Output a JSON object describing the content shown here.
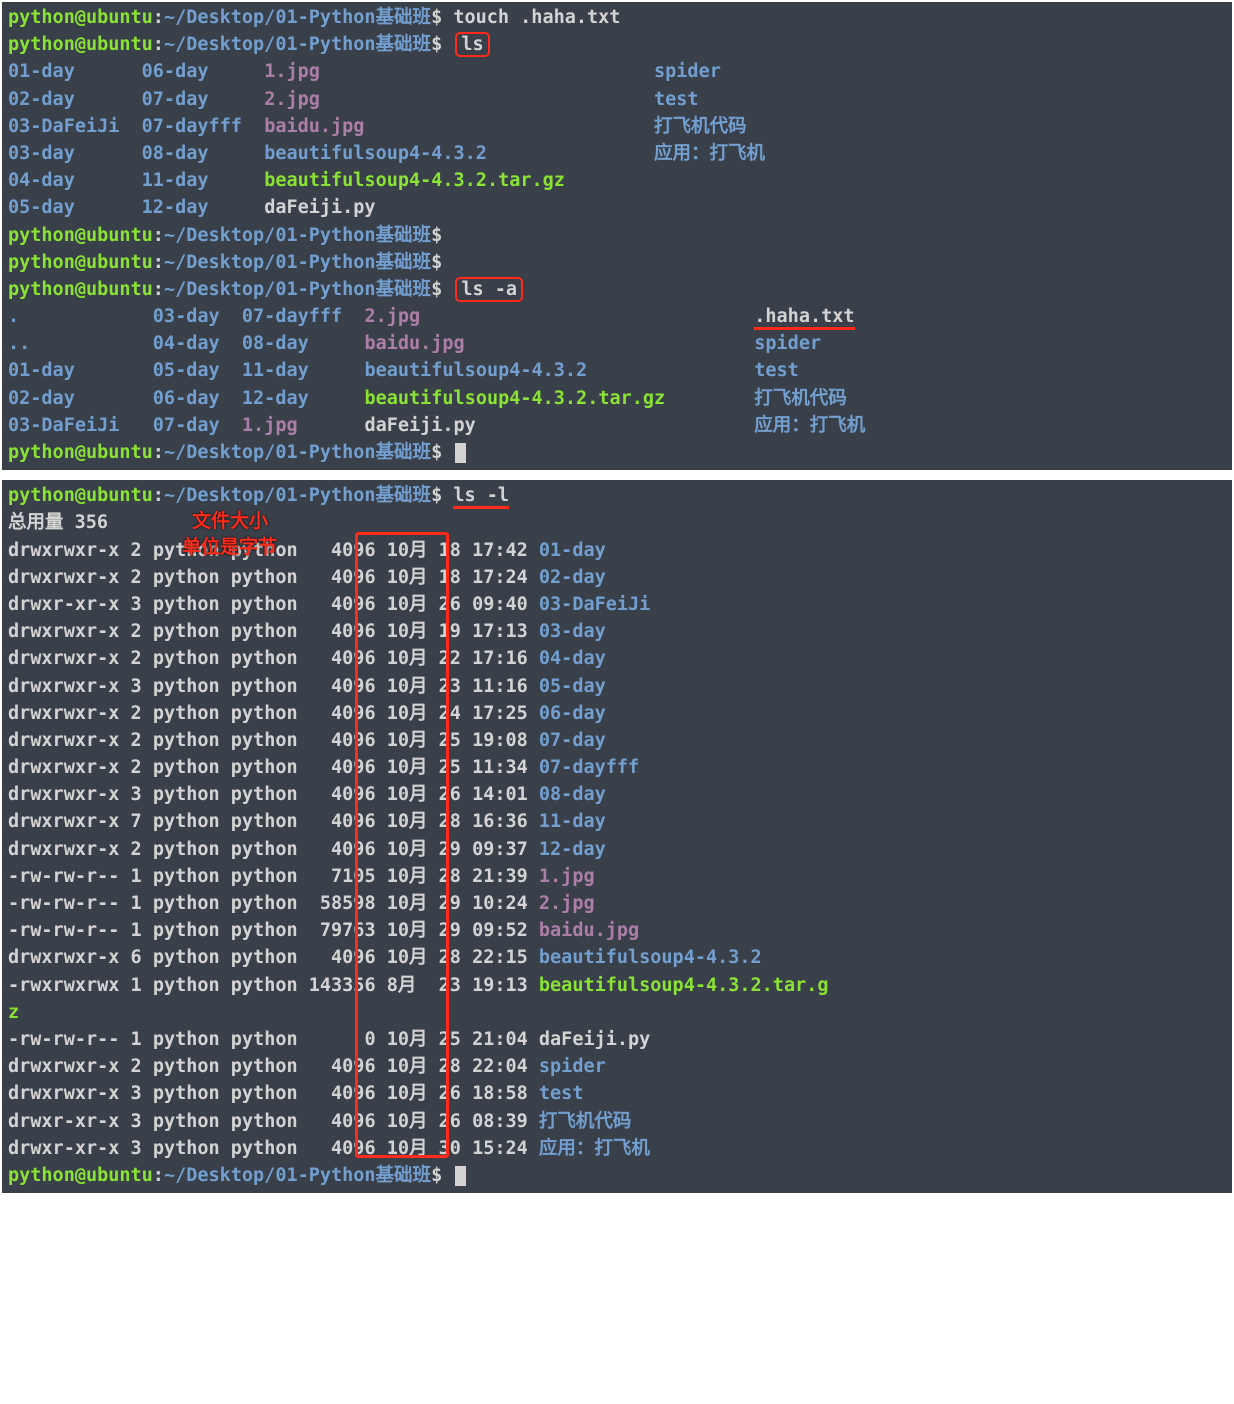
{
  "prompt": {
    "user": "python@ubuntu",
    "sep": ":",
    "path": "~/Desktop/01-Python基础班",
    "dollar": "$"
  },
  "cmds": {
    "touch": "touch .haha.txt",
    "ls": "ls",
    "ls_a": "ls -a",
    "ls_l": "ls -l"
  },
  "ls_plain": {
    "col1": [
      "01-day",
      "02-day",
      "03-DaFeiJi",
      "03-day",
      "04-day",
      "05-day"
    ],
    "col2": [
      "06-day",
      "07-day",
      "07-dayfff",
      "08-day",
      "11-day",
      "12-day"
    ],
    "col3": [
      "1.jpg",
      "2.jpg",
      "baidu.jpg",
      "beautifulsoup4-4.3.2",
      "beautifulsoup4-4.3.2.tar.gz",
      "daFeiji.py"
    ],
    "col4": [
      "spider",
      "test",
      "打飞机代码",
      "应用：打飞机",
      "",
      ""
    ]
  },
  "ls_a": {
    "col1": [
      ".",
      "..",
      "01-day",
      "02-day",
      "03-DaFeiJi"
    ],
    "col2": [
      "03-day",
      "04-day",
      "05-day",
      "06-day",
      "07-day"
    ],
    "col3": [
      "07-dayfff",
      "08-day",
      "11-day",
      "12-day",
      "1.jpg"
    ],
    "col4": [
      "2.jpg",
      "baidu.jpg",
      "beautifulsoup4-4.3.2",
      "beautifulsoup4-4.3.2.tar.gz",
      "daFeiji.py"
    ],
    "col5": [
      ".haha.txt",
      "spider",
      "test",
      "打飞机代码",
      "应用：打飞机"
    ]
  },
  "ls_l": {
    "total": "总用量 356",
    "annotation_line1": "文件大小",
    "annotation_line2": "单位是字节",
    "rows": [
      {
        "perm": "drwxrwxr-x",
        "n": "2",
        "u": "python",
        "g": "python",
        "size": "4096",
        "m": "10月",
        "d": "18",
        "t": "17:42",
        "name": "01-day",
        "cls": "dir"
      },
      {
        "perm": "drwxrwxr-x",
        "n": "2",
        "u": "python",
        "g": "python",
        "size": "4096",
        "m": "10月",
        "d": "18",
        "t": "17:24",
        "name": "02-day",
        "cls": "dir"
      },
      {
        "perm": "drwxr-xr-x",
        "n": "3",
        "u": "python",
        "g": "python",
        "size": "4096",
        "m": "10月",
        "d": "26",
        "t": "09:40",
        "name": "03-DaFeiJi",
        "cls": "dir"
      },
      {
        "perm": "drwxrwxr-x",
        "n": "2",
        "u": "python",
        "g": "python",
        "size": "4096",
        "m": "10月",
        "d": "19",
        "t": "17:13",
        "name": "03-day",
        "cls": "dir"
      },
      {
        "perm": "drwxrwxr-x",
        "n": "2",
        "u": "python",
        "g": "python",
        "size": "4096",
        "m": "10月",
        "d": "22",
        "t": "17:16",
        "name": "04-day",
        "cls": "dir"
      },
      {
        "perm": "drwxrwxr-x",
        "n": "3",
        "u": "python",
        "g": "python",
        "size": "4096",
        "m": "10月",
        "d": "23",
        "t": "11:16",
        "name": "05-day",
        "cls": "dir"
      },
      {
        "perm": "drwxrwxr-x",
        "n": "2",
        "u": "python",
        "g": "python",
        "size": "4096",
        "m": "10月",
        "d": "24",
        "t": "17:25",
        "name": "06-day",
        "cls": "dir"
      },
      {
        "perm": "drwxrwxr-x",
        "n": "2",
        "u": "python",
        "g": "python",
        "size": "4096",
        "m": "10月",
        "d": "25",
        "t": "19:08",
        "name": "07-day",
        "cls": "dir"
      },
      {
        "perm": "drwxrwxr-x",
        "n": "2",
        "u": "python",
        "g": "python",
        "size": "4096",
        "m": "10月",
        "d": "25",
        "t": "11:34",
        "name": "07-dayfff",
        "cls": "dir"
      },
      {
        "perm": "drwxrwxr-x",
        "n": "3",
        "u": "python",
        "g": "python",
        "size": "4096",
        "m": "10月",
        "d": "26",
        "t": "14:01",
        "name": "08-day",
        "cls": "dir"
      },
      {
        "perm": "drwxrwxr-x",
        "n": "7",
        "u": "python",
        "g": "python",
        "size": "4096",
        "m": "10月",
        "d": "28",
        "t": "16:36",
        "name": "11-day",
        "cls": "dir"
      },
      {
        "perm": "drwxrwxr-x",
        "n": "2",
        "u": "python",
        "g": "python",
        "size": "4096",
        "m": "10月",
        "d": "29",
        "t": "09:37",
        "name": "12-day",
        "cls": "dir"
      },
      {
        "perm": "-rw-rw-r--",
        "n": "1",
        "u": "python",
        "g": "python",
        "size": "7105",
        "m": "10月",
        "d": "28",
        "t": "21:39",
        "name": "1.jpg",
        "cls": "img"
      },
      {
        "perm": "-rw-rw-r--",
        "n": "1",
        "u": "python",
        "g": "python",
        "size": "58598",
        "m": "10月",
        "d": "29",
        "t": "10:24",
        "name": "2.jpg",
        "cls": "img"
      },
      {
        "perm": "-rw-rw-r--",
        "n": "1",
        "u": "python",
        "g": "python",
        "size": "79763",
        "m": "10月",
        "d": "29",
        "t": "09:52",
        "name": "baidu.jpg",
        "cls": "img"
      },
      {
        "perm": "drwxrwxr-x",
        "n": "6",
        "u": "python",
        "g": "python",
        "size": "4096",
        "m": "10月",
        "d": "28",
        "t": "22:15",
        "name": "beautifulsoup4-4.3.2",
        "cls": "dir"
      },
      {
        "perm": "-rwxrwxrwx",
        "n": "1",
        "u": "python",
        "g": "python",
        "size": "143356",
        "m": "8月 ",
        "d": "23",
        "t": "19:13",
        "name": "beautifulsoup4-4.3.2.tar.g",
        "cls": "exe",
        "wrap": "z"
      },
      {
        "perm": "-rw-rw-r--",
        "n": "1",
        "u": "python",
        "g": "python",
        "size": "0",
        "m": "10月",
        "d": "25",
        "t": "21:04",
        "name": "daFeiji.py",
        "cls": "plain"
      },
      {
        "perm": "drwxrwxr-x",
        "n": "2",
        "u": "python",
        "g": "python",
        "size": "4096",
        "m": "10月",
        "d": "28",
        "t": "22:04",
        "name": "spider",
        "cls": "dir"
      },
      {
        "perm": "drwxrwxr-x",
        "n": "3",
        "u": "python",
        "g": "python",
        "size": "4096",
        "m": "10月",
        "d": "26",
        "t": "18:58",
        "name": "test",
        "cls": "dir"
      },
      {
        "perm": "drwxr-xr-x",
        "n": "3",
        "u": "python",
        "g": "python",
        "size": "4096",
        "m": "10月",
        "d": "26",
        "t": "08:39",
        "name": "打飞机代码",
        "cls": "dir"
      },
      {
        "perm": "drwxr-xr-x",
        "n": "3",
        "u": "python",
        "g": "python",
        "size": "4096",
        "m": "10月",
        "d": "30",
        "t": "15:24",
        "name": "应用：打飞机",
        "cls": "dir"
      }
    ]
  }
}
